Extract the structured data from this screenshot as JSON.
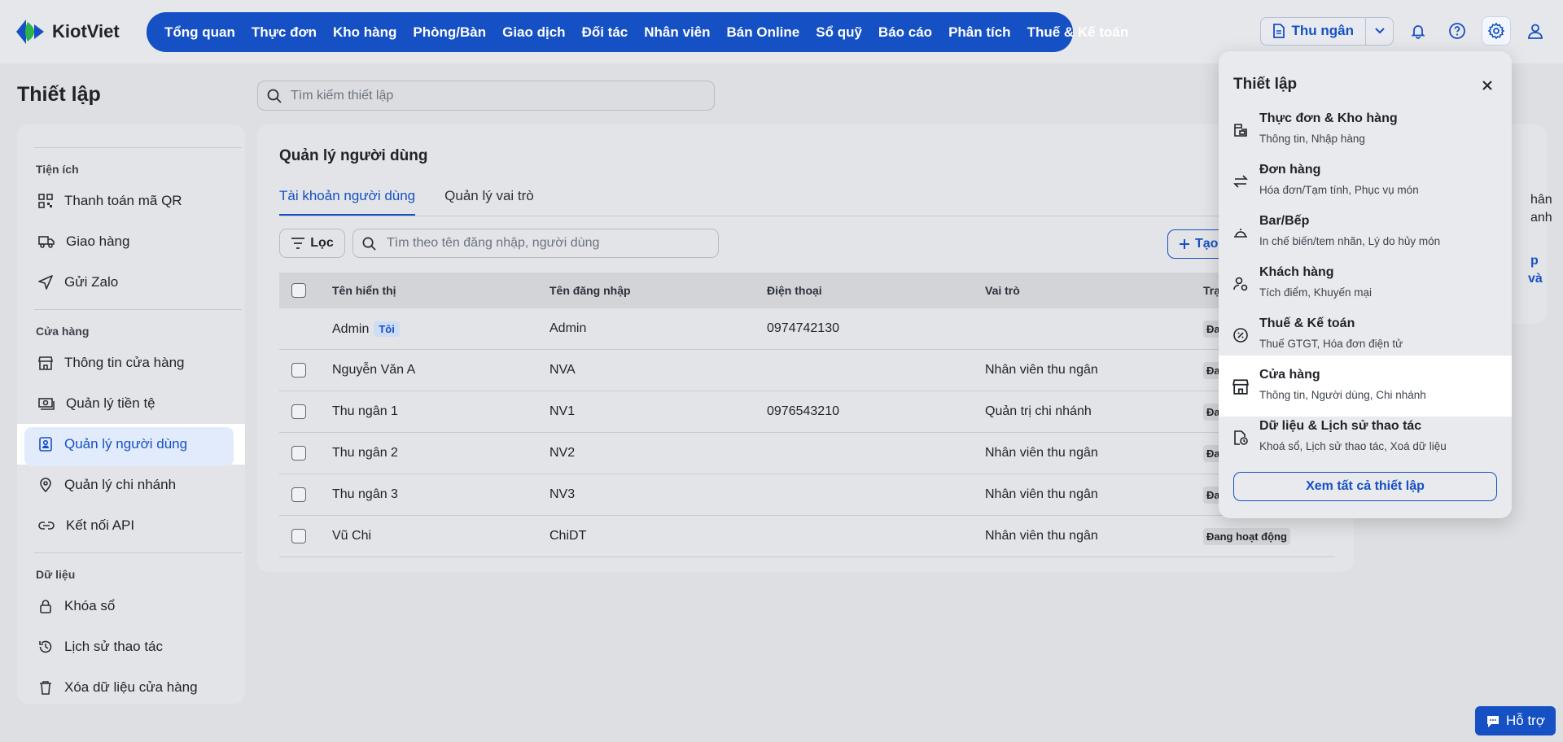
{
  "app": {
    "name": "KiotViet"
  },
  "nav": {
    "items": [
      "Tổng quan",
      "Thực đơn",
      "Kho hàng",
      "Phòng/Bàn",
      "Giao dịch",
      "Đối tác",
      "Nhân viên",
      "Bán Online",
      "Sổ quỹ",
      "Báo cáo",
      "Phân tích",
      "Thuế & Kế toán"
    ]
  },
  "topbar": {
    "cashier_label": "Thu ngân"
  },
  "page": {
    "title": "Thiết lập",
    "search_placeholder": "Tìm kiếm thiết lập"
  },
  "sidebar": {
    "groups": [
      {
        "label": "Tiện ích",
        "items": [
          {
            "label": "Thanh toán mã QR",
            "icon": "qr-icon"
          },
          {
            "label": "Giao hàng",
            "icon": "truck-icon"
          },
          {
            "label": "Gửi Zalo",
            "icon": "send-icon"
          }
        ]
      },
      {
        "label": "Cửa hàng",
        "items": [
          {
            "label": "Thông tin cửa hàng",
            "icon": "store-icon"
          },
          {
            "label": "Quản lý tiền tệ",
            "icon": "money-icon"
          },
          {
            "label": "Quản lý người dùng",
            "icon": "user-card-icon",
            "active": true
          },
          {
            "label": "Quản lý chi nhánh",
            "icon": "location-icon"
          },
          {
            "label": "Kết nối API",
            "icon": "link-icon"
          }
        ]
      },
      {
        "label": "Dữ liệu",
        "items": [
          {
            "label": "Khóa sổ",
            "icon": "lock-icon"
          },
          {
            "label": "Lịch sử thao tác",
            "icon": "history-icon"
          },
          {
            "label": "Xóa dữ liệu cửa hàng",
            "icon": "trash-icon"
          }
        ]
      }
    ]
  },
  "users": {
    "title": "Quản lý người dùng",
    "tabs": [
      "Tài khoản người dùng",
      "Quản lý vai trò"
    ],
    "filter_label": "Lọc",
    "search_placeholder": "Tìm theo tên đăng nhập, người dùng",
    "create_label": "Tạo",
    "columns": [
      "Tên hiển thị",
      "Tên đăng nhập",
      "Điện thoại",
      "Vai trò",
      "Trạ"
    ],
    "me_badge": "Tôi",
    "rows": [
      {
        "name": "Admin",
        "username": "Admin",
        "phone": "0974742130",
        "role": "",
        "status": "Đa",
        "me": true
      },
      {
        "name": "Nguyễn Văn A",
        "username": "NVA",
        "phone": "",
        "role": "Nhân viên thu ngân",
        "status": "Đa"
      },
      {
        "name": "Thu ngân 1",
        "username": "NV1",
        "phone": "0976543210",
        "role": "Quản trị chi nhánh",
        "status": "Đa"
      },
      {
        "name": "Thu ngân 2",
        "username": "NV2",
        "phone": "",
        "role": "Nhân viên thu ngân",
        "status": "Đa"
      },
      {
        "name": "Thu ngân 3",
        "username": "NV3",
        "phone": "",
        "role": "Nhân viên thu ngân",
        "status": "Đa"
      },
      {
        "name": "Vũ Chi",
        "username": "ChiDT",
        "phone": "",
        "role": "Nhân viên thu ngân",
        "status": "Đang hoạt động"
      }
    ]
  },
  "partial_panel": {
    "lines": [
      "hân",
      "anh"
    ],
    "links": [
      "p",
      "và"
    ]
  },
  "settings_menu": {
    "title": "Thiết lập",
    "items": [
      {
        "title": "Thực đơn & Kho hàng",
        "subtitle": "Thông tin, Nhập hàng",
        "icon": "inventory-icon"
      },
      {
        "title": "Đơn hàng",
        "subtitle": "Hóa đơn/Tạm tính, Phục vụ món",
        "icon": "swap-icon"
      },
      {
        "title": "Bar/Bếp",
        "subtitle": "In chế biến/tem nhãn, Lý do hủy món",
        "icon": "cloche-icon"
      },
      {
        "title": "Khách hàng",
        "subtitle": "Tích điểm, Khuyến mại",
        "icon": "customer-icon"
      },
      {
        "title": "Thuế & Kế toán",
        "subtitle": "Thuế GTGT, Hóa đơn điện tử",
        "icon": "tax-icon"
      },
      {
        "title": "Cửa hàng",
        "subtitle": "Thông tin, Người dùng, Chi nhánh",
        "icon": "store-icon",
        "highlighted": true
      },
      {
        "title": "Dữ liệu & Lịch sử thao tác",
        "subtitle": "Khoá sổ, Lịch sử thao tác, Xoá dữ liệu",
        "icon": "data-history-icon"
      }
    ],
    "view_all_label": "Xem tất cả thiết lập"
  },
  "support": {
    "label": "Hỗ trợ"
  },
  "colors": {
    "brand": "#1550c4",
    "logo_green": "#2bb24c",
    "logo_blue": "#1550c4"
  }
}
